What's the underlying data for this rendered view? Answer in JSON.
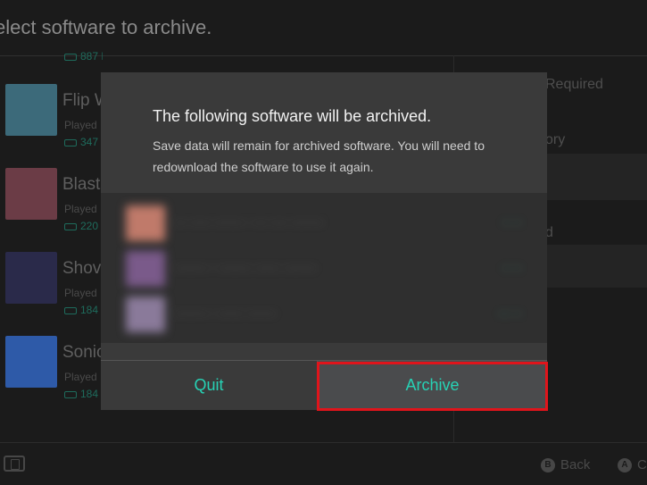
{
  "background": {
    "title": "elect software to archive.",
    "top_row": {
      "size": "887 MB"
    },
    "items": [
      {
        "name": "Flip W",
        "played": "Played",
        "size": "347",
        "thumb_color": "#3c6a7a"
      },
      {
        "name": "Blaste",
        "played": "Played",
        "size": "220",
        "thumb_color": "#6b3c46"
      },
      {
        "name": "Shove",
        "played": "Played",
        "size": "184",
        "thumb_color": "#2a2a4a"
      },
      {
        "name": "Sonic",
        "played": "Played",
        "size": "184",
        "thumb_color": "#2e5aa8"
      }
    ],
    "right_panel": {
      "row1": "Required",
      "row2": "ory",
      "row3": "d"
    },
    "footer": {
      "back_label": "Back",
      "back_button": "B",
      "a_button": "A",
      "a_label": "C"
    }
  },
  "modal": {
    "title": "The following software will be archived.",
    "description": "Save data will remain for archived software. You will need to redownload the software to use it again.",
    "software": [
      {
        "name": "··· ····· ······· · ··· ···· ········",
        "size": "·· ··",
        "thumb_color": "#c07a6a"
      },
      {
        "name": "········ · ········ ······ ········",
        "size": "·· ··",
        "thumb_color": "#7a5a8a"
      },
      {
        "name": "········ · ······ ·······",
        "size": "··· ··",
        "thumb_color": "#8a7a9a"
      }
    ],
    "quit_label": "Quit",
    "archive_label": "Archive"
  },
  "colors": {
    "accent": "#27d2b5",
    "highlight": "#e0141b"
  }
}
